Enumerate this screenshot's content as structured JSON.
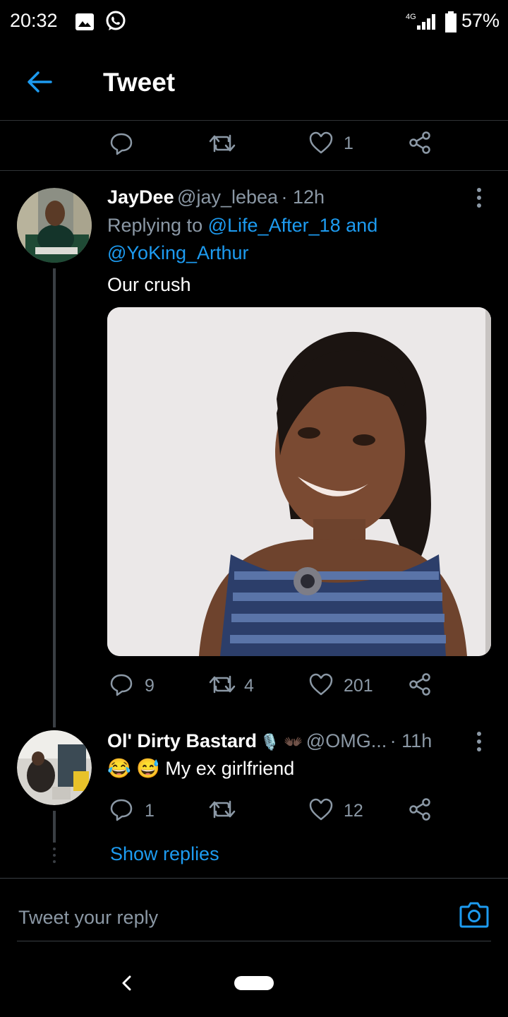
{
  "status_bar": {
    "time": "20:32",
    "network": "4G",
    "battery": "57%"
  },
  "header": {
    "title": "Tweet"
  },
  "top_actions": {
    "like_count": "1"
  },
  "tweet1": {
    "name": "JayDee",
    "handle": "@jay_lebea",
    "time": "· 12h",
    "replying_prefix": "Replying to",
    "mention1": "@Life_After_18",
    "and_word": "and",
    "mention2": "@YoKing_Arthur",
    "text": "Our crush",
    "replies": "9",
    "retweets": "4",
    "likes": "201"
  },
  "tweet2": {
    "name": "Ol' Dirty Bastard",
    "name_emoji": "🎙️ 👐🏿",
    "handle": "@OMG...",
    "time": "· 11h",
    "emoji": "😂 😅",
    "text": "My ex girlfriend",
    "replies": "1",
    "likes": "12",
    "show_replies": "Show replies"
  },
  "composer": {
    "placeholder": "Tweet your reply"
  },
  "colors": {
    "accent": "#1d9bf0",
    "muted": "#8b98a5",
    "background": "#000000"
  }
}
